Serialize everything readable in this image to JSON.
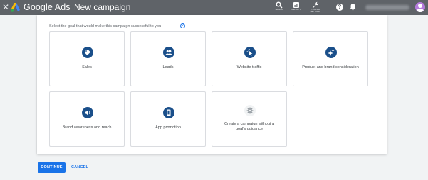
{
  "header": {
    "brand": "Google Ads",
    "page_title": "New campaign",
    "tools": [
      {
        "label": "SEARCH",
        "icon": "search-icon"
      },
      {
        "label": "REPORTS",
        "icon": "reports-icon"
      },
      {
        "label": "TOOLS & SETTINGS",
        "icon": "wrench-icon"
      }
    ]
  },
  "goal_section": {
    "prompt": "Select the goal that would make this campaign successful to you",
    "goals": [
      {
        "label": "Sales",
        "icon": "tag-icon"
      },
      {
        "label": "Leads",
        "icon": "people-icon"
      },
      {
        "label": "Website traffic",
        "icon": "cursor-click-icon"
      },
      {
        "label": "Product and brand consideration",
        "icon": "sparkle-icon"
      },
      {
        "label": "Brand awareness and reach",
        "icon": "speaker-icon"
      },
      {
        "label": "App promotion",
        "icon": "phone-icon"
      },
      {
        "label": "Create a campaign without a goal's guidance",
        "icon": "gear-icon"
      }
    ]
  },
  "footer": {
    "continue_label": "CONTINUE",
    "cancel_label": "CANCEL"
  },
  "colors": {
    "topbar": "#5f6368",
    "accent": "#1a73e8",
    "goal_icon_bg": "#1a4f8a"
  }
}
